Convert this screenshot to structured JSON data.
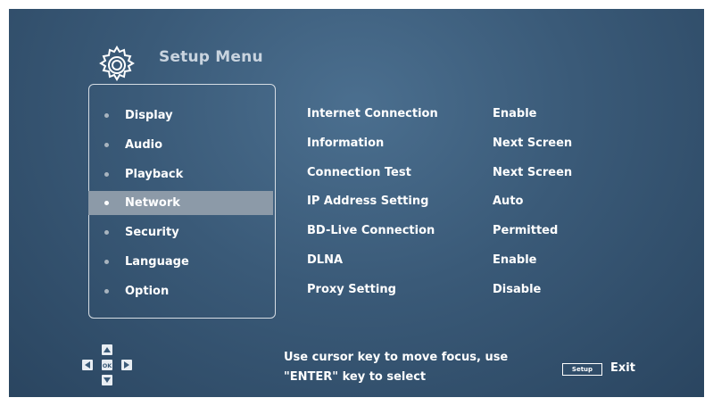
{
  "header": {
    "icon": "gear-icon",
    "title": "Setup Menu"
  },
  "menu": {
    "selected_index": 3,
    "items": [
      {
        "label": "Display"
      },
      {
        "label": "Audio"
      },
      {
        "label": "Playback"
      },
      {
        "label": "Network"
      },
      {
        "label": "Security"
      },
      {
        "label": "Language"
      },
      {
        "label": "Option"
      }
    ]
  },
  "settings": [
    {
      "name": "Internet Connection",
      "value": "Enable"
    },
    {
      "name": "Information",
      "value": "Next Screen"
    },
    {
      "name": "Connection Test",
      "value": "Next Screen"
    },
    {
      "name": "IP Address Setting",
      "value": "Auto"
    },
    {
      "name": "BD-Live Connection",
      "value": "Permitted"
    },
    {
      "name": "DLNA",
      "value": "Enable"
    },
    {
      "name": "Proxy Setting",
      "value": "Disable"
    }
  ],
  "footer": {
    "dpad_icon": "dpad-icon",
    "dpad_center_label": "OK",
    "hint_line1": "Use cursor key to move focus, use",
    "hint_line2": "\"ENTER\" key to select",
    "setup_key_label": "Setup",
    "exit_label": "Exit"
  },
  "colors": {
    "background": "#3a5a78",
    "selected_highlight": "#8c9aa8",
    "text": "#ffffff",
    "title_text": "#c9d4df"
  }
}
